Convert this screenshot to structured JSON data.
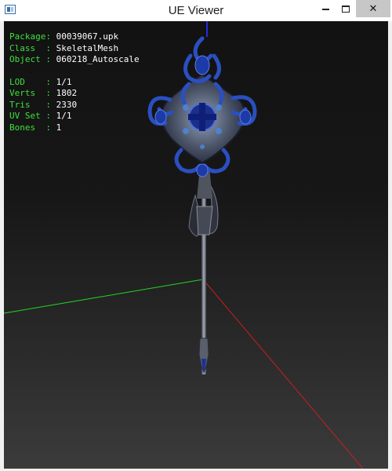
{
  "window": {
    "title": "UE Viewer"
  },
  "titlebar": {
    "close_glyph": "✕"
  },
  "info": [
    {
      "label": "Package",
      "value": "00039067.upk"
    },
    {
      "label": "Class  ",
      "value": "SkeletalMesh"
    },
    {
      "label": "Object ",
      "value": "060218_Autoscale"
    }
  ],
  "stats": [
    {
      "label": "LOD    ",
      "value": "1/1"
    },
    {
      "label": "Verts  ",
      "value": "1802"
    },
    {
      "label": "Tris   ",
      "value": "2330"
    },
    {
      "label": "UV Set ",
      "value": "1/1"
    },
    {
      "label": "Bones  ",
      "value": "1"
    }
  ],
  "colors": {
    "label": "#3de03d",
    "value": "#ffffff",
    "axis_x": "#c81e1e",
    "axis_y": "#25d625",
    "axis_z": "#2a2ad8",
    "mesh_blue": "#2a4fc0"
  },
  "icons": {
    "app": "app-window-icon",
    "minimize": "minimize-icon",
    "maximize": "maximize-icon",
    "close": "close-icon"
  }
}
